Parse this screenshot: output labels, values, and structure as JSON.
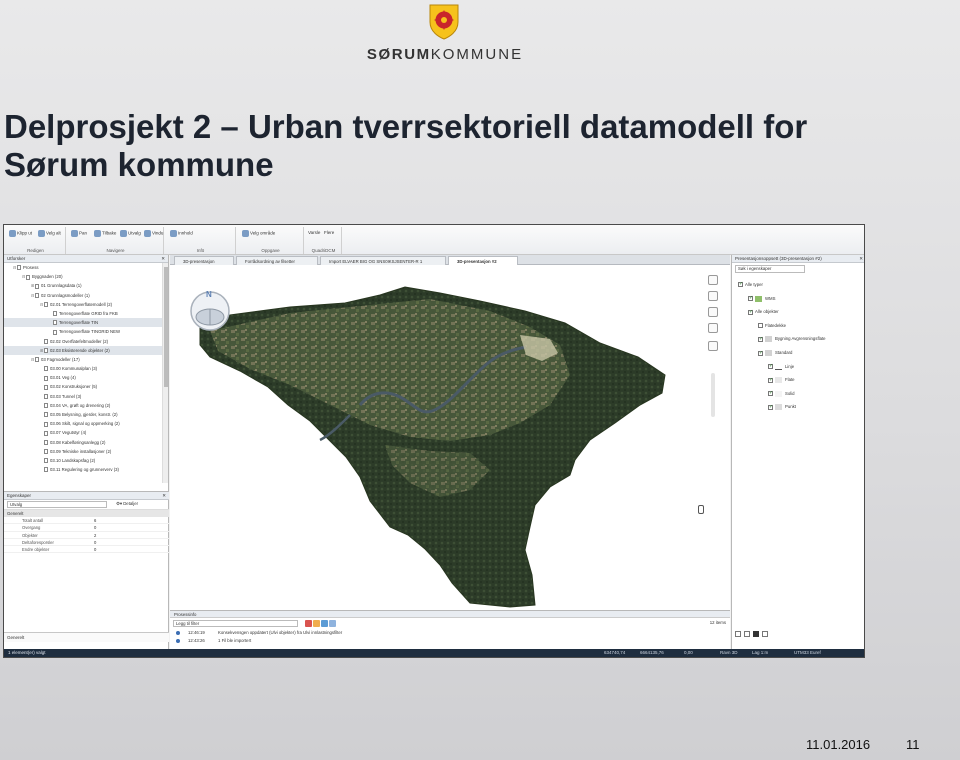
{
  "logo": {
    "word_bold": "SØRUM",
    "word_light": "KOMMUNE"
  },
  "slide": {
    "title_line1": "Delprosjekt 2 – Urban tverrsektoriell datamodell for",
    "title_line2": "Sørum kommune",
    "date": "11.01.2016",
    "page_number": "11"
  },
  "app": {
    "ribbon": {
      "groups": [
        "Redigen",
        "Navigere",
        "Infö",
        "Oppgave",
        "QuadriDCM"
      ],
      "buttons": [
        "Klipp ut",
        "Velg alt",
        "Pan",
        "Tilbake",
        "Utvalg",
        "Vindu",
        "Innhold",
        "Velg område",
        "Varsle",
        "Flere"
      ]
    },
    "left_panel": {
      "title": "Utforsker",
      "close": "✕",
      "tree": [
        {
          "label": "Prosess",
          "indent": 1,
          "expander": "⊟"
        },
        {
          "label": "Byggnaden (20)",
          "indent": 2,
          "expander": "⊟"
        },
        {
          "label": "01 Grunnlagsdata (1)",
          "indent": 3,
          "expander": "⊞"
        },
        {
          "label": "02 Grunnlagsmodeller (1)",
          "indent": 3,
          "expander": "⊟"
        },
        {
          "label": "02.01 Terrengoverflatemodell (2)",
          "indent": 4,
          "expander": "⊟"
        },
        {
          "label": "Terrengoverflate GRID fra FKB",
          "indent": 5,
          "expander": ""
        },
        {
          "label": "Terrengoverflate TIN",
          "indent": 5,
          "expander": "",
          "selected": true
        },
        {
          "label": "Terrengoverflate TINGRID NEW",
          "indent": 5,
          "expander": ""
        },
        {
          "label": "02.02 Overflatefeltmodeller (2)",
          "indent": 4,
          "expander": ""
        },
        {
          "label": "02.03 Eksisterende objekter (2)",
          "indent": 4,
          "expander": "⊞",
          "selected": true
        },
        {
          "label": "03 Fagmodeller (17)",
          "indent": 3,
          "expander": "⊟"
        },
        {
          "label": "03.00 Kommunalplan (3)",
          "indent": 4,
          "expander": ""
        },
        {
          "label": "03.01 Veg (4)",
          "indent": 4,
          "expander": ""
        },
        {
          "label": "03.02 Konstruksjoner (5)",
          "indent": 4,
          "expander": ""
        },
        {
          "label": "03.03 Tunnel (3)",
          "indent": 4,
          "expander": ""
        },
        {
          "label": "03.04 VA, grøft og drenering (2)",
          "indent": 4,
          "expander": ""
        },
        {
          "label": "03.05 Belysning, gjerder, konstr. (2)",
          "indent": 4,
          "expander": ""
        },
        {
          "label": "03.06 Skilt, signal og oppmerking (2)",
          "indent": 4,
          "expander": ""
        },
        {
          "label": "03.07 Vegutstyr (4)",
          "indent": 4,
          "expander": ""
        },
        {
          "label": "03.08 Kabelføringsanlegg (2)",
          "indent": 4,
          "expander": ""
        },
        {
          "label": "03.09 Tekniske installasjoner (2)",
          "indent": 4,
          "expander": ""
        },
        {
          "label": "03.10 Landskapsfag (2)",
          "indent": 4,
          "expander": ""
        },
        {
          "label": "03.11 Regulering og grunnerverv (3)",
          "indent": 4,
          "expander": ""
        }
      ],
      "properties": {
        "title": "Egenskaper",
        "select_value": "Utvalg",
        "details": "⚙▾ Detaljer",
        "group": "Generelt",
        "rows": [
          {
            "k": "Totalt antall",
            "v": "6"
          },
          {
            "k": "Overgang",
            "v": "0"
          },
          {
            "k": "Objekter",
            "v": "2"
          },
          {
            "k": "Deltaforesporsler",
            "v": "0"
          },
          {
            "k": "Endre objekter",
            "v": "0"
          }
        ],
        "footer": "Generelt"
      }
    },
    "tabs": [
      "3D-presentasjon",
      "Forrådsordning av filsetter",
      "Import ELVAER BIG OG SNS0IKSJSENTER-R 1",
      "3D-presentasjon #2"
    ],
    "active_tab_index": 3,
    "viewport": {
      "compass_label": "N"
    },
    "process_panel": {
      "title": "Prosessinfo",
      "filter_placeholder": "Legg til filter",
      "items_count": "12 items",
      "lines": [
        {
          "time": "12:46:19",
          "text": "Konsekvensgen oppdatert (Ulvi objekter) fra Ulvi innlastningsfilter"
        },
        {
          "time": "12:43:26",
          "text": "1 Fil ble importert"
        }
      ]
    },
    "right_panel": {
      "title": "Presentasjonsoppsett (3D-presentasjon #2)",
      "search_placeholder": "Søk i egenskaper",
      "layers": [
        {
          "label": "Alle typer",
          "level": 0,
          "checked": true,
          "swatch": "none"
        },
        {
          "label": "WMS",
          "level": 1,
          "checked": true,
          "swatch": "wms"
        },
        {
          "label": "Alle objekter",
          "level": 1,
          "checked": true,
          "swatch": "none"
        },
        {
          "label": "Flatedekke",
          "level": 2,
          "checked": false,
          "swatch": "none"
        },
        {
          "label": "Bygning Avgrensningsflate",
          "level": 2,
          "checked": true,
          "swatch": "grey"
        },
        {
          "label": "Standard",
          "level": 2,
          "checked": true,
          "swatch": "grey"
        },
        {
          "label": "Linje",
          "level": 3,
          "checked": true,
          "swatch": "line"
        },
        {
          "label": "Flate",
          "level": 3,
          "checked": true,
          "swatch": "flat"
        },
        {
          "label": "Solid",
          "level": 3,
          "checked": true,
          "swatch": "solid"
        },
        {
          "label": "Punkt",
          "level": 3,
          "checked": true,
          "swatch": "point"
        }
      ]
    },
    "statusbar": {
      "left": "1 element(er) valgt",
      "items": [
        "634740,74",
        "6664135,76",
        "0,00",
        "Ravn 3D",
        "Lag 1:m",
        "UTM33 Euref"
      ]
    },
    "colors": {
      "statusbar": "#1e2d3f",
      "terrain_forest": "#2f3f2b",
      "river": "#4a5a66"
    }
  }
}
